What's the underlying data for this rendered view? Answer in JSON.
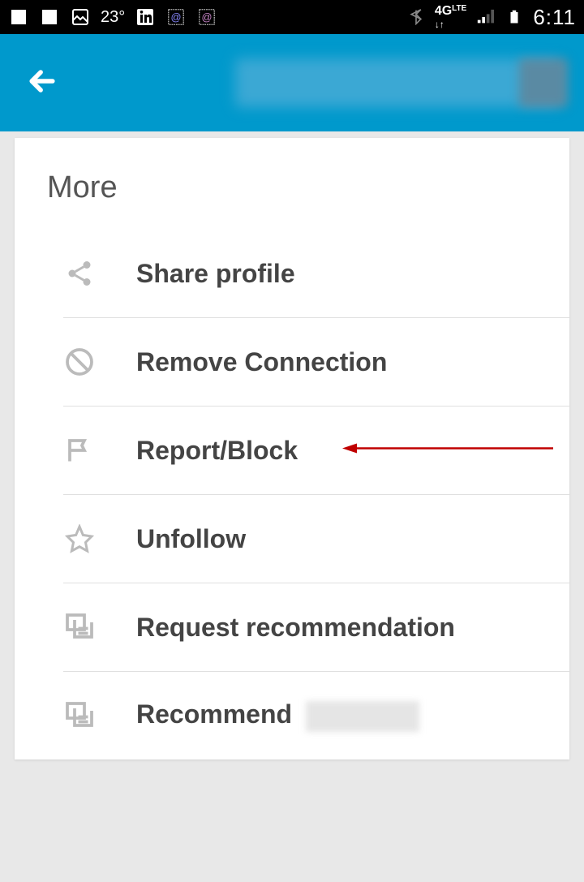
{
  "status_bar": {
    "temperature": "23°",
    "network_label": "4G LTE",
    "time": "6:11"
  },
  "header": {
    "title_redacted": ""
  },
  "card": {
    "title": "More"
  },
  "menu": {
    "items": [
      {
        "icon": "share-icon",
        "label": "Share profile"
      },
      {
        "icon": "block-icon",
        "label": "Remove Connection"
      },
      {
        "icon": "flag-icon",
        "label": "Report/Block",
        "highlighted": true
      },
      {
        "icon": "star-icon",
        "label": "Unfollow"
      },
      {
        "icon": "recommend-icon",
        "label": "Request recommendation"
      },
      {
        "icon": "recommend-icon",
        "label": "Recommend ",
        "redacted_suffix": true
      }
    ]
  },
  "annotation": {
    "arrow_target_index": 2,
    "arrow_color": "#c00000"
  }
}
